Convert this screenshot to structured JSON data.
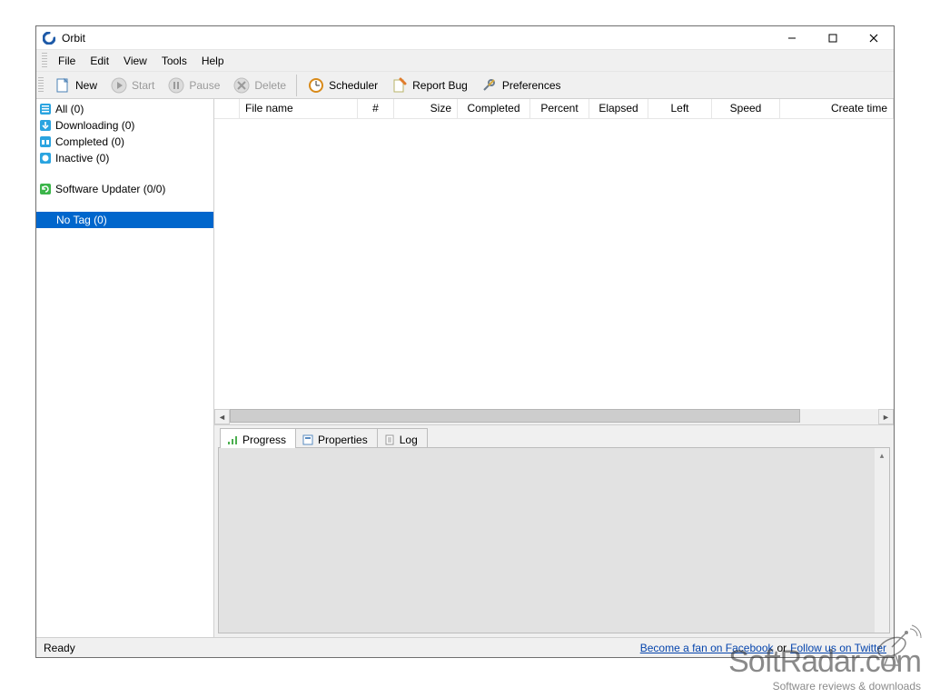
{
  "window": {
    "title": "Orbit"
  },
  "menu": {
    "file": "File",
    "edit": "Edit",
    "view": "View",
    "tools": "Tools",
    "help": "Help"
  },
  "toolbar": {
    "new": "New",
    "start": "Start",
    "pause": "Pause",
    "delete": "Delete",
    "scheduler": "Scheduler",
    "report_bug": "Report Bug",
    "preferences": "Preferences"
  },
  "sidebar": {
    "all": "All (0)",
    "downloading": "Downloading (0)",
    "completed": "Completed (0)",
    "inactive": "Inactive (0)",
    "updater": "Software Updater (0/0)",
    "notag": "No Tag (0)"
  },
  "columns": {
    "blank": "",
    "filename": "File name",
    "hash": "#",
    "size": "Size",
    "completed": "Completed",
    "percent": "Percent",
    "elapsed": "Elapsed",
    "left": "Left",
    "speed": "Speed",
    "create_time": "Create time"
  },
  "tabs": {
    "progress": "Progress",
    "properties": "Properties",
    "log": "Log"
  },
  "status": {
    "ready": "Ready",
    "fb": "Become a fan on Facebook",
    "or": "or",
    "tw": "Follow us on Twitter"
  },
  "watermark": {
    "title": "SoftRadar.com",
    "sub": "Software reviews & downloads"
  }
}
